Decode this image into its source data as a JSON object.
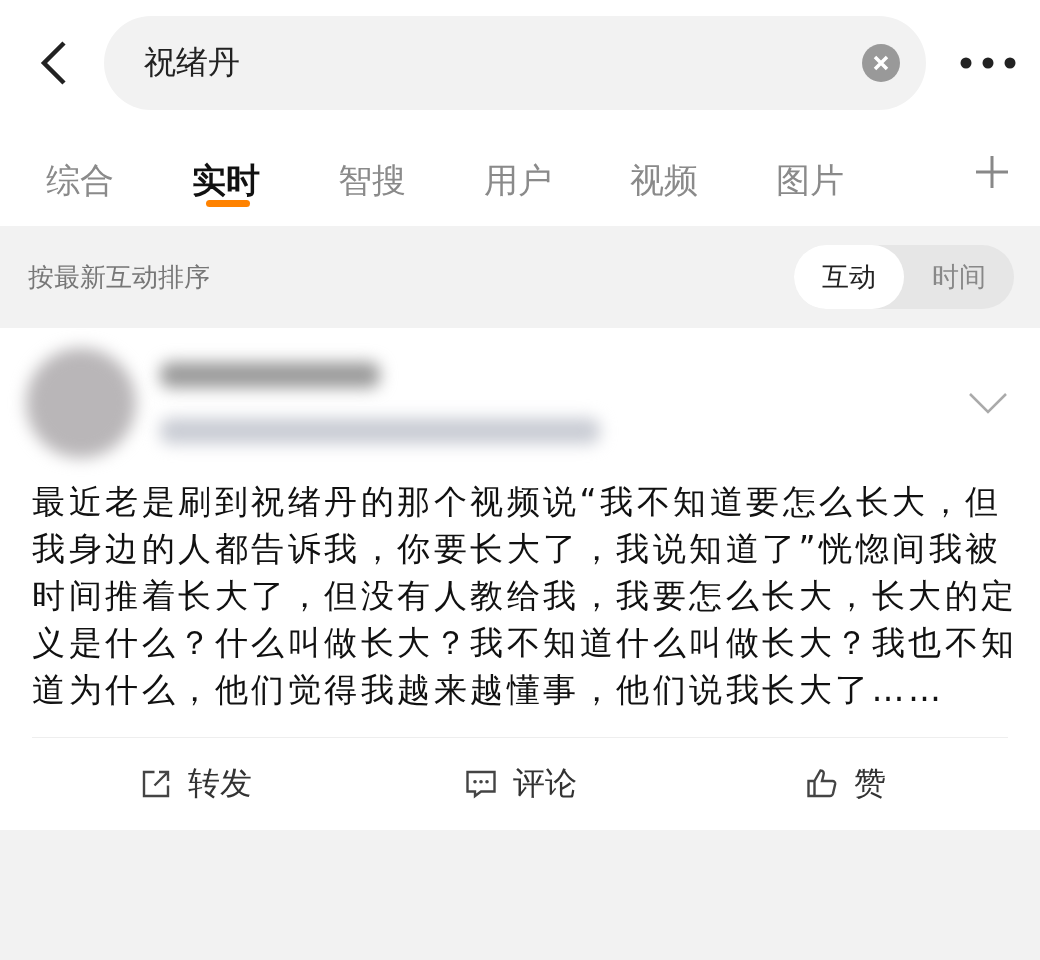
{
  "search": {
    "value": "祝绪丹"
  },
  "tabs": [
    {
      "label": "综合",
      "selected": false
    },
    {
      "label": "实时",
      "selected": true
    },
    {
      "label": "智搜",
      "selected": false
    },
    {
      "label": "用户",
      "selected": false
    },
    {
      "label": "视频",
      "selected": false
    },
    {
      "label": "图片",
      "selected": false
    }
  ],
  "sort_bar": {
    "label": "按最新互动排序",
    "options": [
      {
        "label": "互动",
        "selected": true
      },
      {
        "label": "时间",
        "selected": false
      }
    ]
  },
  "post": {
    "text": "最近老是刷到祝绪丹的那个视频说“我不知道要怎么长大，但我身边的人都告诉我，你要长大了，我说知道了”恍惚间我被时间推着长大了，但没有人教给我，我要怎么长大，长大的定义是什么？什么叫做长大？我不知道什么叫做长大？我也不知道为什么，他们觉得我越来越懂事，他们说我长大了……",
    "actions": [
      {
        "kind": "repost",
        "label": "转发"
      },
      {
        "kind": "comment",
        "label": "评论"
      },
      {
        "kind": "like",
        "label": "赞"
      }
    ]
  }
}
